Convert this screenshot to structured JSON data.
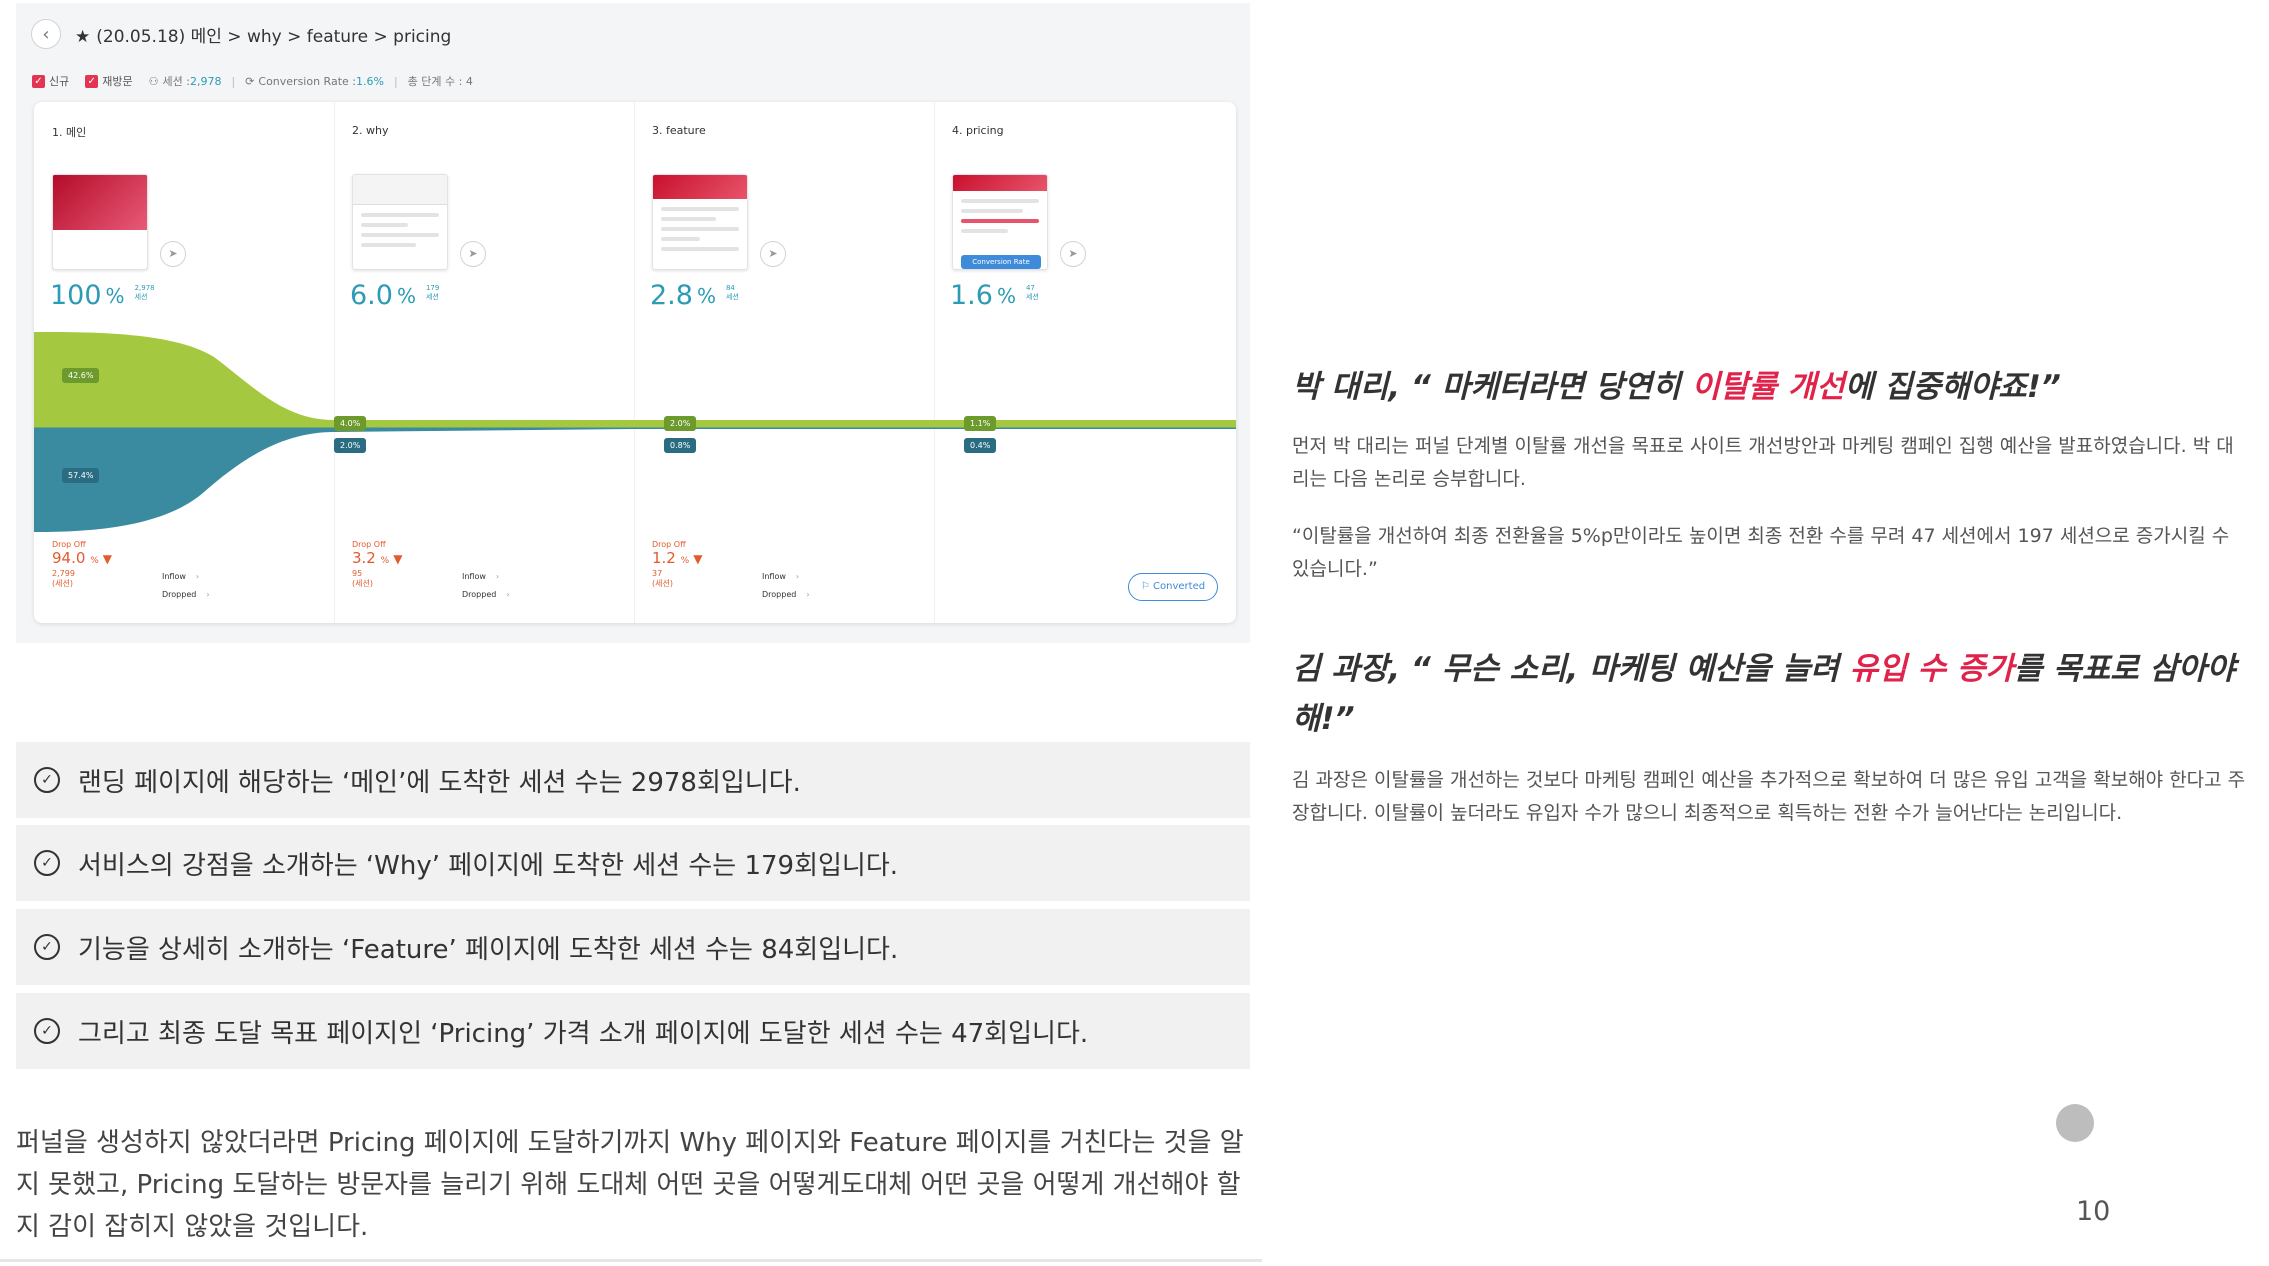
{
  "funnel": {
    "header": {
      "back_icon": "chevron-left-icon",
      "title": "(20.05.18) 메인 > why > feature > pricing"
    },
    "filters": {
      "new_label": "신규",
      "returning_label": "재방문",
      "sessions_label": "세션 : ",
      "sessions_value": "2,978",
      "conversion_label": "Conversion Rate : ",
      "conversion_value": "1.6%",
      "steps_label": "총 단계 수 : 4"
    },
    "steps": [
      {
        "label": "1. 메인",
        "pct": "100",
        "count": "2,978",
        "unit": "세션",
        "bar_top_pct": "42.6%",
        "bar_bottom_pct": "57.4%",
        "drop_label": "Drop Off",
        "drop_pct": "94.0",
        "drop_count": "2,799",
        "drop_unit": "(세션)",
        "inflow": "Inflow",
        "dropped": "Dropped"
      },
      {
        "label": "2. why",
        "pct": "6.0",
        "count": "179",
        "unit": "세션",
        "bar_top_pct": "4.0%",
        "bar_bottom_pct": "2.0%",
        "drop_label": "Drop Off",
        "drop_pct": "3.2",
        "drop_count": "95",
        "drop_unit": "(세션)",
        "inflow": "Inflow",
        "dropped": "Dropped"
      },
      {
        "label": "3. feature",
        "pct": "2.8",
        "count": "84",
        "unit": "세션",
        "bar_top_pct": "2.0%",
        "bar_bottom_pct": "0.8%",
        "drop_label": "Drop Off",
        "drop_pct": "1.2",
        "drop_count": "37",
        "drop_unit": "(세션)",
        "inflow": "Inflow",
        "dropped": "Dropped"
      },
      {
        "label": "4. pricing",
        "pct": "1.6",
        "count": "47",
        "unit": "세션",
        "bar_top_pct": "1.1%",
        "bar_bottom_pct": "0.4%",
        "badge": "Conversion Rate"
      }
    ],
    "converted_label": "Converted",
    "colors": {
      "green": "#9dc43c",
      "blue": "#3a8aa0",
      "accent": "#2c9bb5",
      "drop": "#e35a2f"
    }
  },
  "bullets": [
    "랜딩 페이지에 해당하는 ‘메인’에 도착한 세션 수는 2978회입니다.",
    "서비스의 강점을 소개하는 ‘Why’ 페이지에 도착한 세션 수는 179회입니다.",
    "기능을 상세히 소개하는 ‘Feature’ 페이지에 도착한 세션 수는 84회입니다.",
    "그리고 최종 도달 목표 페이지인 ‘Pricing’ 가격 소개 페이지에 도달한 세션 수는 47회입니다."
  ],
  "bottom_paragraph": "퍼널을 생성하지 않았더라면 Pricing 페이지에 도달하기까지 Why 페이지와 Feature 페이지를 거친다는 것을 알지 못했고, Pricing 도달하는 방문자를 늘리기 위해 도대체 어떤 곳을 어떻게도대체 어떤 곳을 어떻게 개선해야 할지 감이 잡히지 않았을 것입니다.",
  "right": {
    "quote1": {
      "pre": "박 대리, “ 마케터라면 당연히 ",
      "highlight": "이탈률 개선",
      "post": "에 집중해야죠!”"
    },
    "para1": "먼저 박 대리는 퍼널 단계별 이탈률 개선을 목표로 사이트 개선방안과 마케팅 캠페인 집행 예산을 발표하였습니다. 박 대리는 다음 논리로 승부합니다.",
    "para2": "“이탈률을 개선하여 최종 전환율을 5%p만이라도 높이면 최종 전환 수를 무려 47 세션에서 197 세션으로 증가시킬 수 있습니다.”",
    "quote2": {
      "pre": "김 과장, “ 무슨 소리, 마케팅 예산을 늘려 ",
      "highlight": "유입 수 증가",
      "post": "를 목표로 삼아야 해!”"
    },
    "para3": "김 과장은 이탈률을 개선하는 것보다 마케팅 캠페인 예산을 추가적으로 확보하여 더 많은 유입 고객을 확보해야 한다고 주장합니다. 이탈률이 높더라도 유입자 수가 많으니 최종적으로 획득하는 전환 수가 늘어난다는 논리입니다."
  },
  "page_number": "10"
}
